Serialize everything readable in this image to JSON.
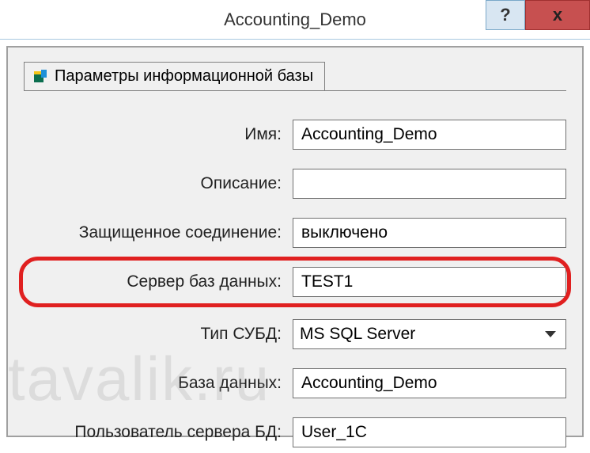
{
  "window": {
    "title": "Accounting_Demo",
    "help_label": "?",
    "close_label": "x"
  },
  "tab": {
    "label": "Параметры информационной базы"
  },
  "fields": {
    "name": {
      "label": "Имя:",
      "value": "Accounting_Demo"
    },
    "description": {
      "label": "Описание:",
      "value": ""
    },
    "secure": {
      "label": "Защищенное соединение:",
      "value": "выключено"
    },
    "db_server": {
      "label": "Сервер баз данных:",
      "value": "TEST1"
    },
    "dbms_type": {
      "label": "Тип СУБД:",
      "value": "MS SQL Server"
    },
    "database": {
      "label": "База данных:",
      "value": "Accounting_Demo"
    },
    "db_user": {
      "label": "Пользователь сервера БД:",
      "value": "User_1C"
    }
  },
  "watermark": "tavalik.ru"
}
